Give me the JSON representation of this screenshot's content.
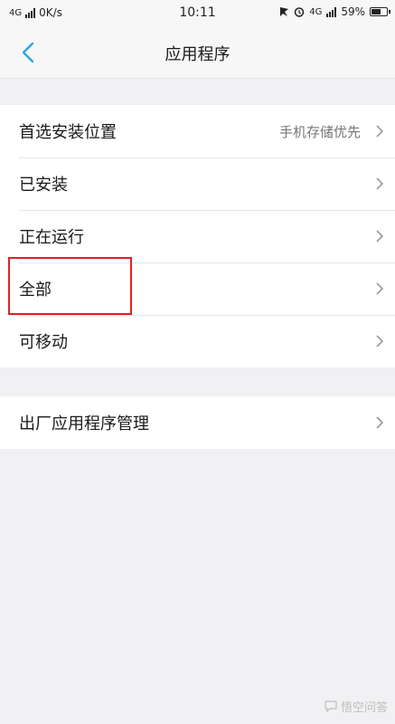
{
  "status_bar": {
    "network": "4G",
    "speed": "0K/s",
    "time": "10:11",
    "network_right": "4G",
    "battery": "59%"
  },
  "header": {
    "title": "应用程序"
  },
  "group1": {
    "items": [
      {
        "label": "首选安装位置",
        "value": "手机存储优先"
      },
      {
        "label": "已安装"
      },
      {
        "label": "正在运行"
      },
      {
        "label": "全部"
      },
      {
        "label": "可移动"
      }
    ]
  },
  "group2": {
    "items": [
      {
        "label": "出厂应用程序管理"
      }
    ]
  },
  "watermark": {
    "text": "悟空问答"
  },
  "colors": {
    "accent": "#2aa6e8",
    "highlight": "#e02020",
    "background": "#f1f1f3"
  }
}
